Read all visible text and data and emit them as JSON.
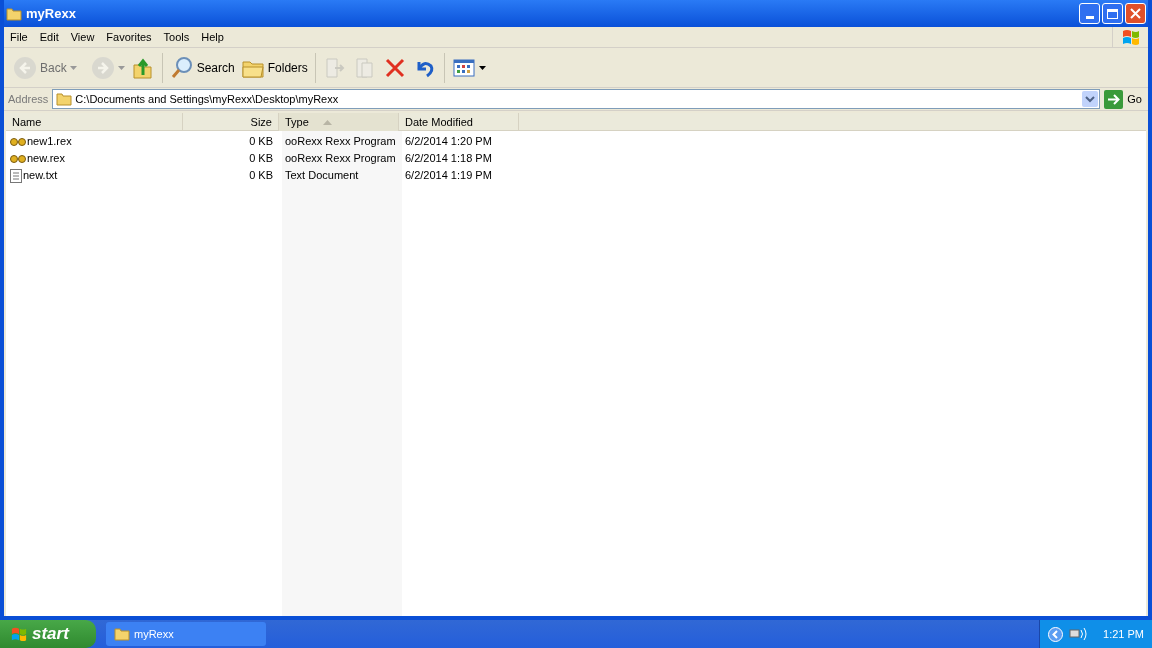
{
  "window": {
    "title": "myRexx"
  },
  "menu": [
    "File",
    "Edit",
    "View",
    "Favorites",
    "Tools",
    "Help"
  ],
  "toolbar": [
    {
      "kind": "back",
      "label": "Back",
      "disabled": true
    },
    {
      "kind": "forward",
      "disabled": true
    },
    {
      "kind": "up",
      "disabled": false
    },
    {
      "kind": "search",
      "label": "Search",
      "disabled": false
    },
    {
      "kind": "folders",
      "label": "Folders",
      "disabled": false
    },
    {
      "kind": "move",
      "disabled": true
    },
    {
      "kind": "copy",
      "disabled": true
    },
    {
      "kind": "delete",
      "disabled": false
    },
    {
      "kind": "undo",
      "disabled": false
    },
    {
      "kind": "views",
      "disabled": false
    }
  ],
  "address": {
    "label": "Address",
    "value": "C:\\Documents and Settings\\myRexx\\Desktop\\myRexx",
    "go": "Go"
  },
  "table": {
    "columns": [
      {
        "label": "Name",
        "sorted": false
      },
      {
        "label": "Size",
        "sorted": false
      },
      {
        "label": "Type",
        "sorted": true
      },
      {
        "label": "Date Modified",
        "sorted": false
      }
    ],
    "rows": [
      {
        "kind": "rexx",
        "cells": [
          "new1.rex",
          "0 KB",
          "ooRexx Rexx Program",
          "6/2/2014 1:20 PM"
        ]
      },
      {
        "kind": "rexx",
        "cells": [
          "new.rex",
          "0 KB",
          "ooRexx Rexx Program",
          "6/2/2014 1:18 PM"
        ]
      },
      {
        "kind": "text",
        "cells": [
          "new.txt",
          "0 KB",
          "Text Document",
          "6/2/2014 1:19 PM"
        ]
      }
    ]
  },
  "taskbar": {
    "start": "start",
    "tasks": [
      {
        "label": "myRexx",
        "selected": false
      }
    ],
    "clock": "1:21 PM"
  }
}
